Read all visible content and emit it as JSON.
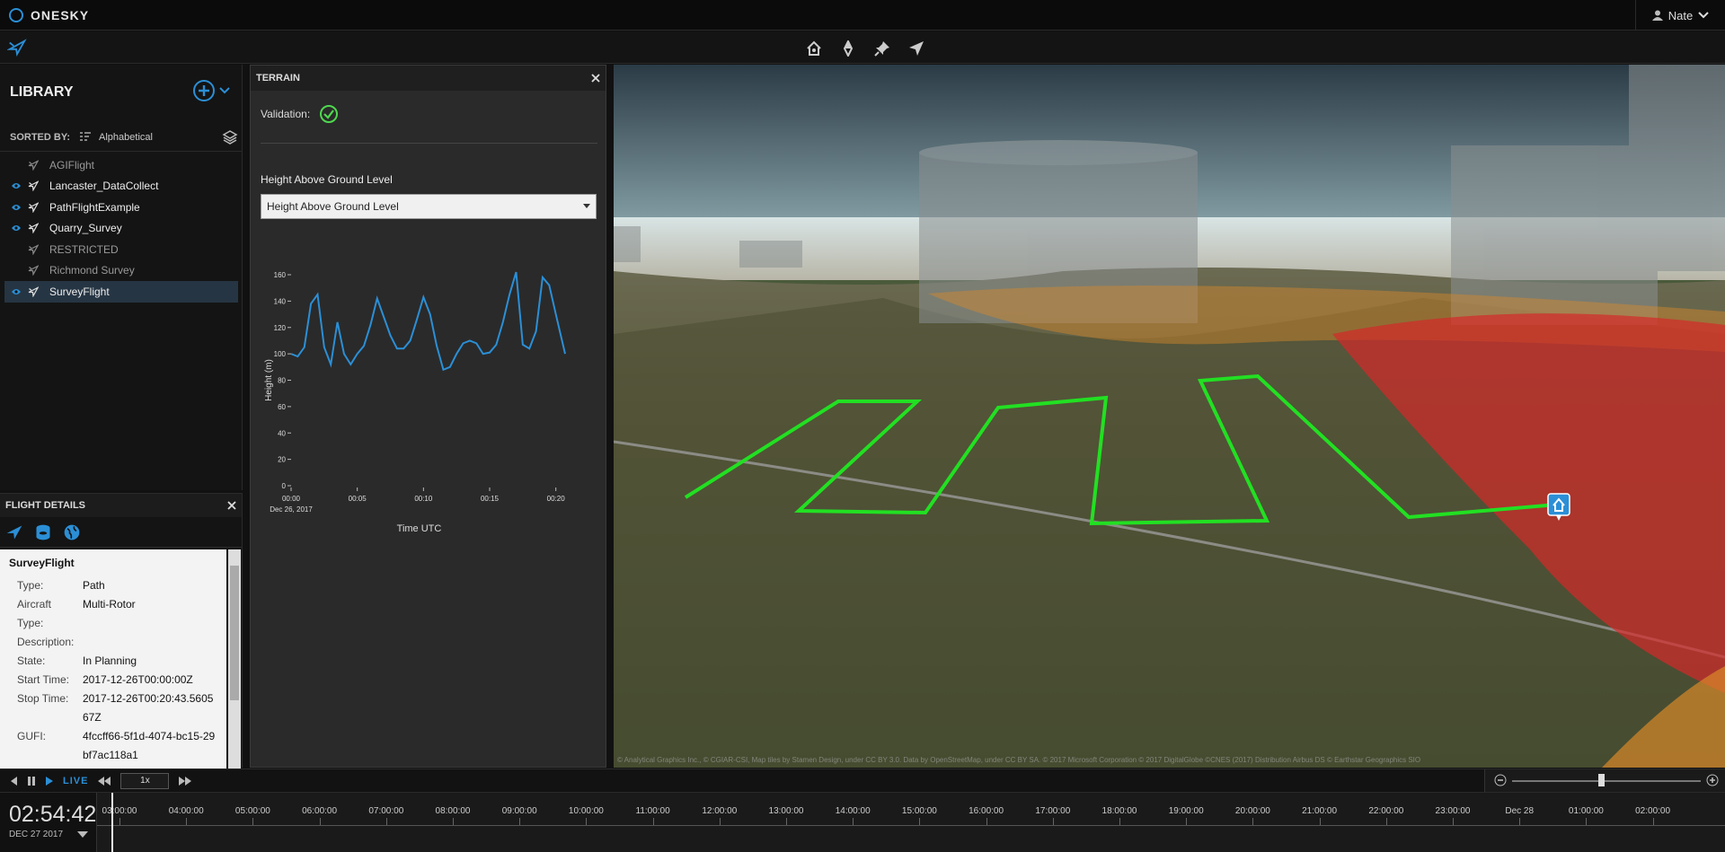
{
  "app": {
    "name": "ONESKY",
    "user": "Nate"
  },
  "library": {
    "title": "LIBRARY",
    "sorted_by_label": "SORTED BY:",
    "sorted_by_value": "Alphabetical",
    "items": [
      {
        "label": "AGIFlight",
        "visible": false
      },
      {
        "label": "Lancaster_DataCollect",
        "visible": true
      },
      {
        "label": "PathFlightExample",
        "visible": true
      },
      {
        "label": "Quarry_Survey",
        "visible": true
      },
      {
        "label": "RESTRICTED",
        "visible": false
      },
      {
        "label": "Richmond Survey",
        "visible": false
      },
      {
        "label": "SurveyFlight",
        "visible": true,
        "selected": true
      }
    ]
  },
  "details": {
    "title": "FLIGHT DETAILS",
    "flight_name": "SurveyFlight",
    "fields": [
      {
        "k": "Type:",
        "v": "Path"
      },
      {
        "k": "Aircraft",
        "v": "Multi-Rotor"
      },
      {
        "k": "Type:",
        "v": ""
      },
      {
        "k": "Description:",
        "v": ""
      },
      {
        "k": "State:",
        "v": "In Planning"
      },
      {
        "k": "Start Time:",
        "v": "2017-12-26T00:00:00Z"
      },
      {
        "k": "Stop Time:",
        "v": "2017-12-26T00:20:43.560567Z"
      },
      {
        "k": "GUFI:",
        "v": "4fccff66-5f1d-4074-bc15-29bf7ac118a1"
      }
    ]
  },
  "terrain": {
    "title": "TERRAIN",
    "validation_label": "Validation:",
    "hagl_label": "Height Above Ground Level",
    "select_value": "Height Above Ground Level"
  },
  "chart_data": {
    "type": "line",
    "title": "",
    "xlabel": "Time UTC",
    "ylabel": "Height (m)",
    "x_ticks": [
      "00:00",
      "00:05",
      "00:10",
      "00:15",
      "00:20"
    ],
    "x_sub": "Dec 26, 2017",
    "y_ticks": [
      0,
      20,
      40,
      60,
      80,
      100,
      120,
      140,
      160
    ],
    "ylim": [
      0,
      160
    ],
    "xlim": [
      0,
      20.7
    ],
    "x": [
      0,
      0.5,
      1.0,
      1.5,
      2.0,
      2.5,
      3.0,
      3.5,
      4.0,
      4.5,
      5.0,
      5.5,
      6.0,
      6.5,
      7.0,
      7.5,
      8.0,
      8.5,
      9.0,
      9.5,
      10.0,
      10.5,
      11.0,
      11.5,
      12.0,
      12.5,
      13.0,
      13.5,
      14.0,
      14.5,
      15.0,
      15.5,
      16.0,
      16.5,
      17.0,
      17.5,
      18.0,
      18.5,
      19.0,
      19.5,
      20.0,
      20.7
    ],
    "series": [
      {
        "values": [
          100,
          98,
          105,
          138,
          145,
          105,
          92,
          124,
          100,
          92,
          100,
          106,
          122,
          142,
          128,
          114,
          104,
          104,
          110,
          126,
          143,
          130,
          106,
          88,
          90,
          100,
          108,
          110,
          108,
          100,
          101,
          107,
          124,
          145,
          162,
          107,
          104,
          117,
          158,
          152,
          130,
          100
        ]
      }
    ]
  },
  "timeline": {
    "clock_time": "02:54:42",
    "clock_date": "DEC 27 2017",
    "live_label": "LIVE",
    "speed": "1x",
    "ticks": [
      "03:00:00",
      "04:00:00",
      "05:00:00",
      "06:00:00",
      "07:00:00",
      "08:00:00",
      "09:00:00",
      "10:00:00",
      "11:00:00",
      "12:00:00",
      "13:00:00",
      "14:00:00",
      "15:00:00",
      "16:00:00",
      "17:00:00",
      "18:00:00",
      "19:00:00",
      "20:00:00",
      "21:00:00",
      "22:00:00",
      "23:00:00",
      "Dec 28",
      "01:00:00",
      "02:00:00"
    ]
  },
  "map": {
    "attribution": "© Analytical Graphics Inc., © CGIAR-CSI, Map tiles by Stamen Design, under CC BY 3.0. Data by OpenStreetMap, under CC BY SA. © 2017 Microsoft Corporation © 2017 DigitalGlobe ©CNES (2017) Distribution Airbus DS © Earthstar Geographics SIO"
  },
  "colors": {
    "accent": "#2b8fd6",
    "path": "#22e022",
    "restricted": "#d42a2a",
    "warning": "#d9892a"
  }
}
